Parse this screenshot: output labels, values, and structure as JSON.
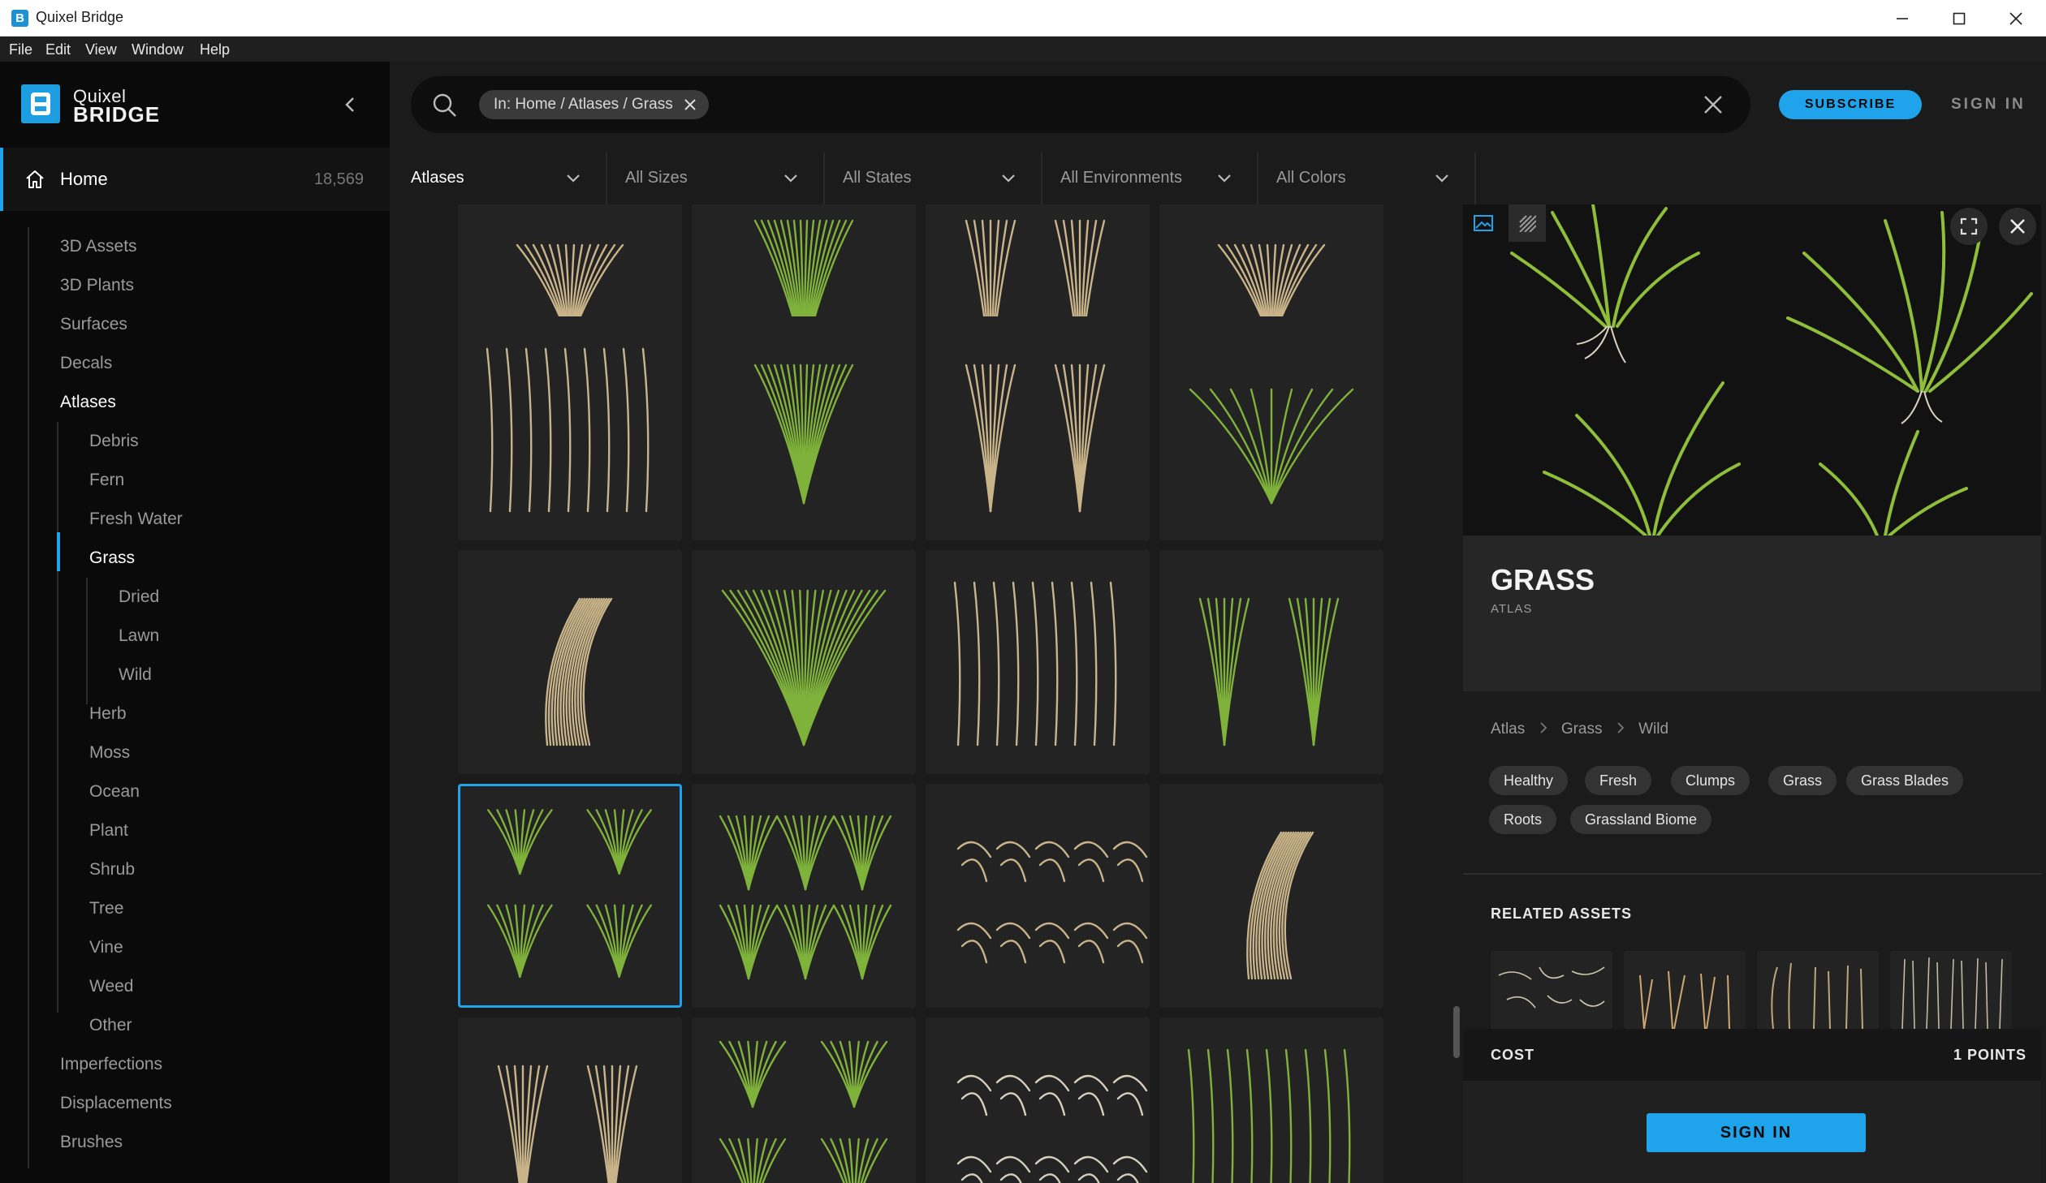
{
  "window": {
    "title": "Quixel Bridge"
  },
  "menu": [
    "File",
    "Edit",
    "View",
    "Window",
    "Help"
  ],
  "sidebar": {
    "brand_top": "Quixel",
    "brand_bottom": "BRIDGE",
    "home_label": "Home",
    "home_count": "18,569",
    "items": [
      {
        "label": "3D Assets",
        "level": 1
      },
      {
        "label": "3D Plants",
        "level": 1
      },
      {
        "label": "Surfaces",
        "level": 1
      },
      {
        "label": "Decals",
        "level": 1
      },
      {
        "label": "Atlases",
        "level": 1,
        "active": true
      },
      {
        "label": "Debris",
        "level": 2
      },
      {
        "label": "Fern",
        "level": 2
      },
      {
        "label": "Fresh Water",
        "level": 2
      },
      {
        "label": "Grass",
        "level": 2,
        "active": true
      },
      {
        "label": "Dried",
        "level": 3
      },
      {
        "label": "Lawn",
        "level": 3
      },
      {
        "label": "Wild",
        "level": 3
      },
      {
        "label": "Herb",
        "level": 2
      },
      {
        "label": "Moss",
        "level": 2
      },
      {
        "label": "Ocean",
        "level": 2
      },
      {
        "label": "Plant",
        "level": 2
      },
      {
        "label": "Shrub",
        "level": 2
      },
      {
        "label": "Tree",
        "level": 2
      },
      {
        "label": "Vine",
        "level": 2
      },
      {
        "label": "Weed",
        "level": 2
      },
      {
        "label": "Other",
        "level": 2
      },
      {
        "label": "Imperfections",
        "level": 1
      },
      {
        "label": "Displacements",
        "level": 1
      },
      {
        "label": "Brushes",
        "level": 1
      }
    ]
  },
  "search": {
    "chip": "In: Home / Atlases / Grass",
    "query": ""
  },
  "header": {
    "subscribe": "SUBSCRIBE",
    "sign_in": "SIGN IN"
  },
  "filters": [
    "Atlases",
    "All Sizes",
    "All States",
    "All Environments",
    "All Colors"
  ],
  "detail": {
    "title": "GRASS",
    "type": "ATLAS",
    "breadcrumb": [
      "Atlas",
      "Grass",
      "Wild"
    ],
    "tags": [
      "Healthy",
      "Fresh",
      "Clumps",
      "Grass",
      "Grass Blades",
      "Roots",
      "Grassland Biome"
    ],
    "related_header": "RELATED ASSETS",
    "cost_label": "COST",
    "cost_value": "1 POINTS",
    "sign_in_button": "SIGN IN"
  },
  "colors": {
    "accent": "#1fa3ea",
    "sidebar_bg": "#0a0a0a",
    "main_bg": "#1b1b1b",
    "tile_bg": "#232323"
  }
}
